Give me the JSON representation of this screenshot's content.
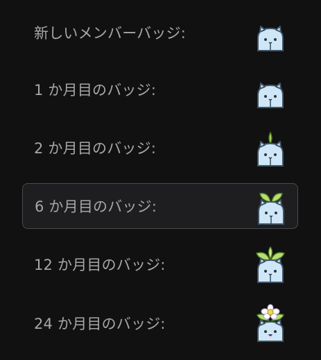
{
  "colors": {
    "background": "#111111",
    "selected_row": "#1e1e20",
    "selected_border": "#4a4a4e",
    "text": "#a7a7aa",
    "badge_body": "#cfe6f7",
    "sprout": "#9ed35a"
  },
  "badges": [
    {
      "label": "新しいメンバーバッジ:",
      "icon": "mascot-plain-icon",
      "selected": false
    },
    {
      "label": "1 か月目のバッジ:",
      "icon": "mascot-plain-icon",
      "selected": false
    },
    {
      "label": "2 か月目のバッジ:",
      "icon": "mascot-seed-icon",
      "selected": false
    },
    {
      "label": "6 か月目のバッジ:",
      "icon": "mascot-sprout-icon",
      "selected": true
    },
    {
      "label": "12 か月目のバッジ:",
      "icon": "mascot-leaves-icon",
      "selected": false
    },
    {
      "label": "24 か月目のバッジ:",
      "icon": "mascot-flower-icon",
      "selected": false
    }
  ]
}
